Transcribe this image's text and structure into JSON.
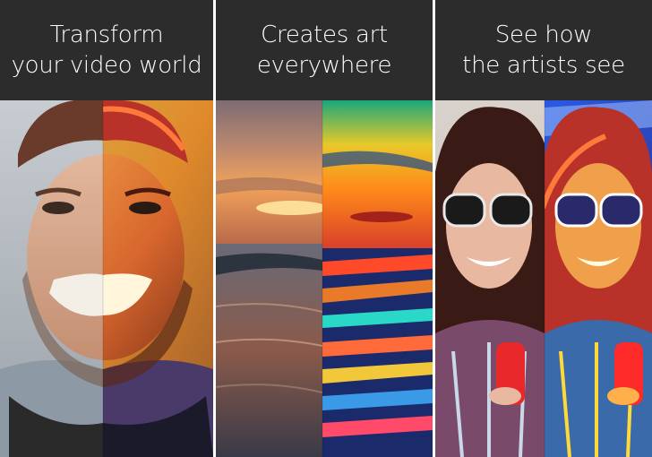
{
  "panels": [
    {
      "title": "Transform\nyour video world",
      "image": "split-face-portrait"
    },
    {
      "title": "Creates art\neverywhere",
      "image": "split-sunset-beach"
    },
    {
      "title": "See how\nthe artists see",
      "image": "split-selfie-girl"
    }
  ]
}
